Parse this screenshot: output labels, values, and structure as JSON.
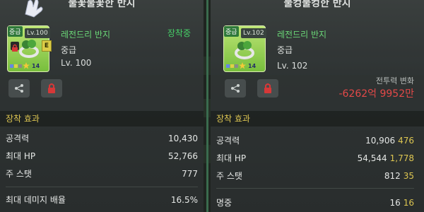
{
  "left": {
    "title": "불꽃불꽃한 반지",
    "grade": "중급",
    "level_tag": "Lv.100",
    "name": "레전드리 반지",
    "grade_text": "중급",
    "level_text": "Lv. 100",
    "stars": "14",
    "status": "장착중",
    "section": "장착 효과",
    "stats": [
      {
        "label": "공격력",
        "value": "10,430"
      },
      {
        "label": "최대 HP",
        "value": "52,766"
      },
      {
        "label": "주 스탯",
        "value": "777"
      },
      {
        "label": "최대 데미지 배율",
        "value": "16.5%"
      }
    ]
  },
  "right": {
    "title": "물컹물컹한 반지",
    "grade": "중급",
    "level_tag": "Lv.102",
    "name": "레전드리 반지",
    "grade_text": "중급",
    "level_text": "Lv. 102",
    "stars": "14",
    "power_label": "전투력 변화",
    "power_value": "-6262억 9952만",
    "section": "장착 효과",
    "stats": [
      {
        "label": "공격력",
        "value": "10,906",
        "diff": "476"
      },
      {
        "label": "최대 HP",
        "value": "54,544",
        "diff": "1,778"
      },
      {
        "label": "주 스탯",
        "value": "812",
        "diff": "35"
      },
      {
        "label": "명중",
        "value": "16",
        "diff": "16"
      }
    ]
  },
  "colors": {
    "item_name": "#6fe07c",
    "equipped": "#49d96b",
    "section_header": "#e8cf54",
    "stat_diff": "#e8cf54",
    "power_negative": "#ee4b4b",
    "lock_red": "#e03a3a"
  }
}
